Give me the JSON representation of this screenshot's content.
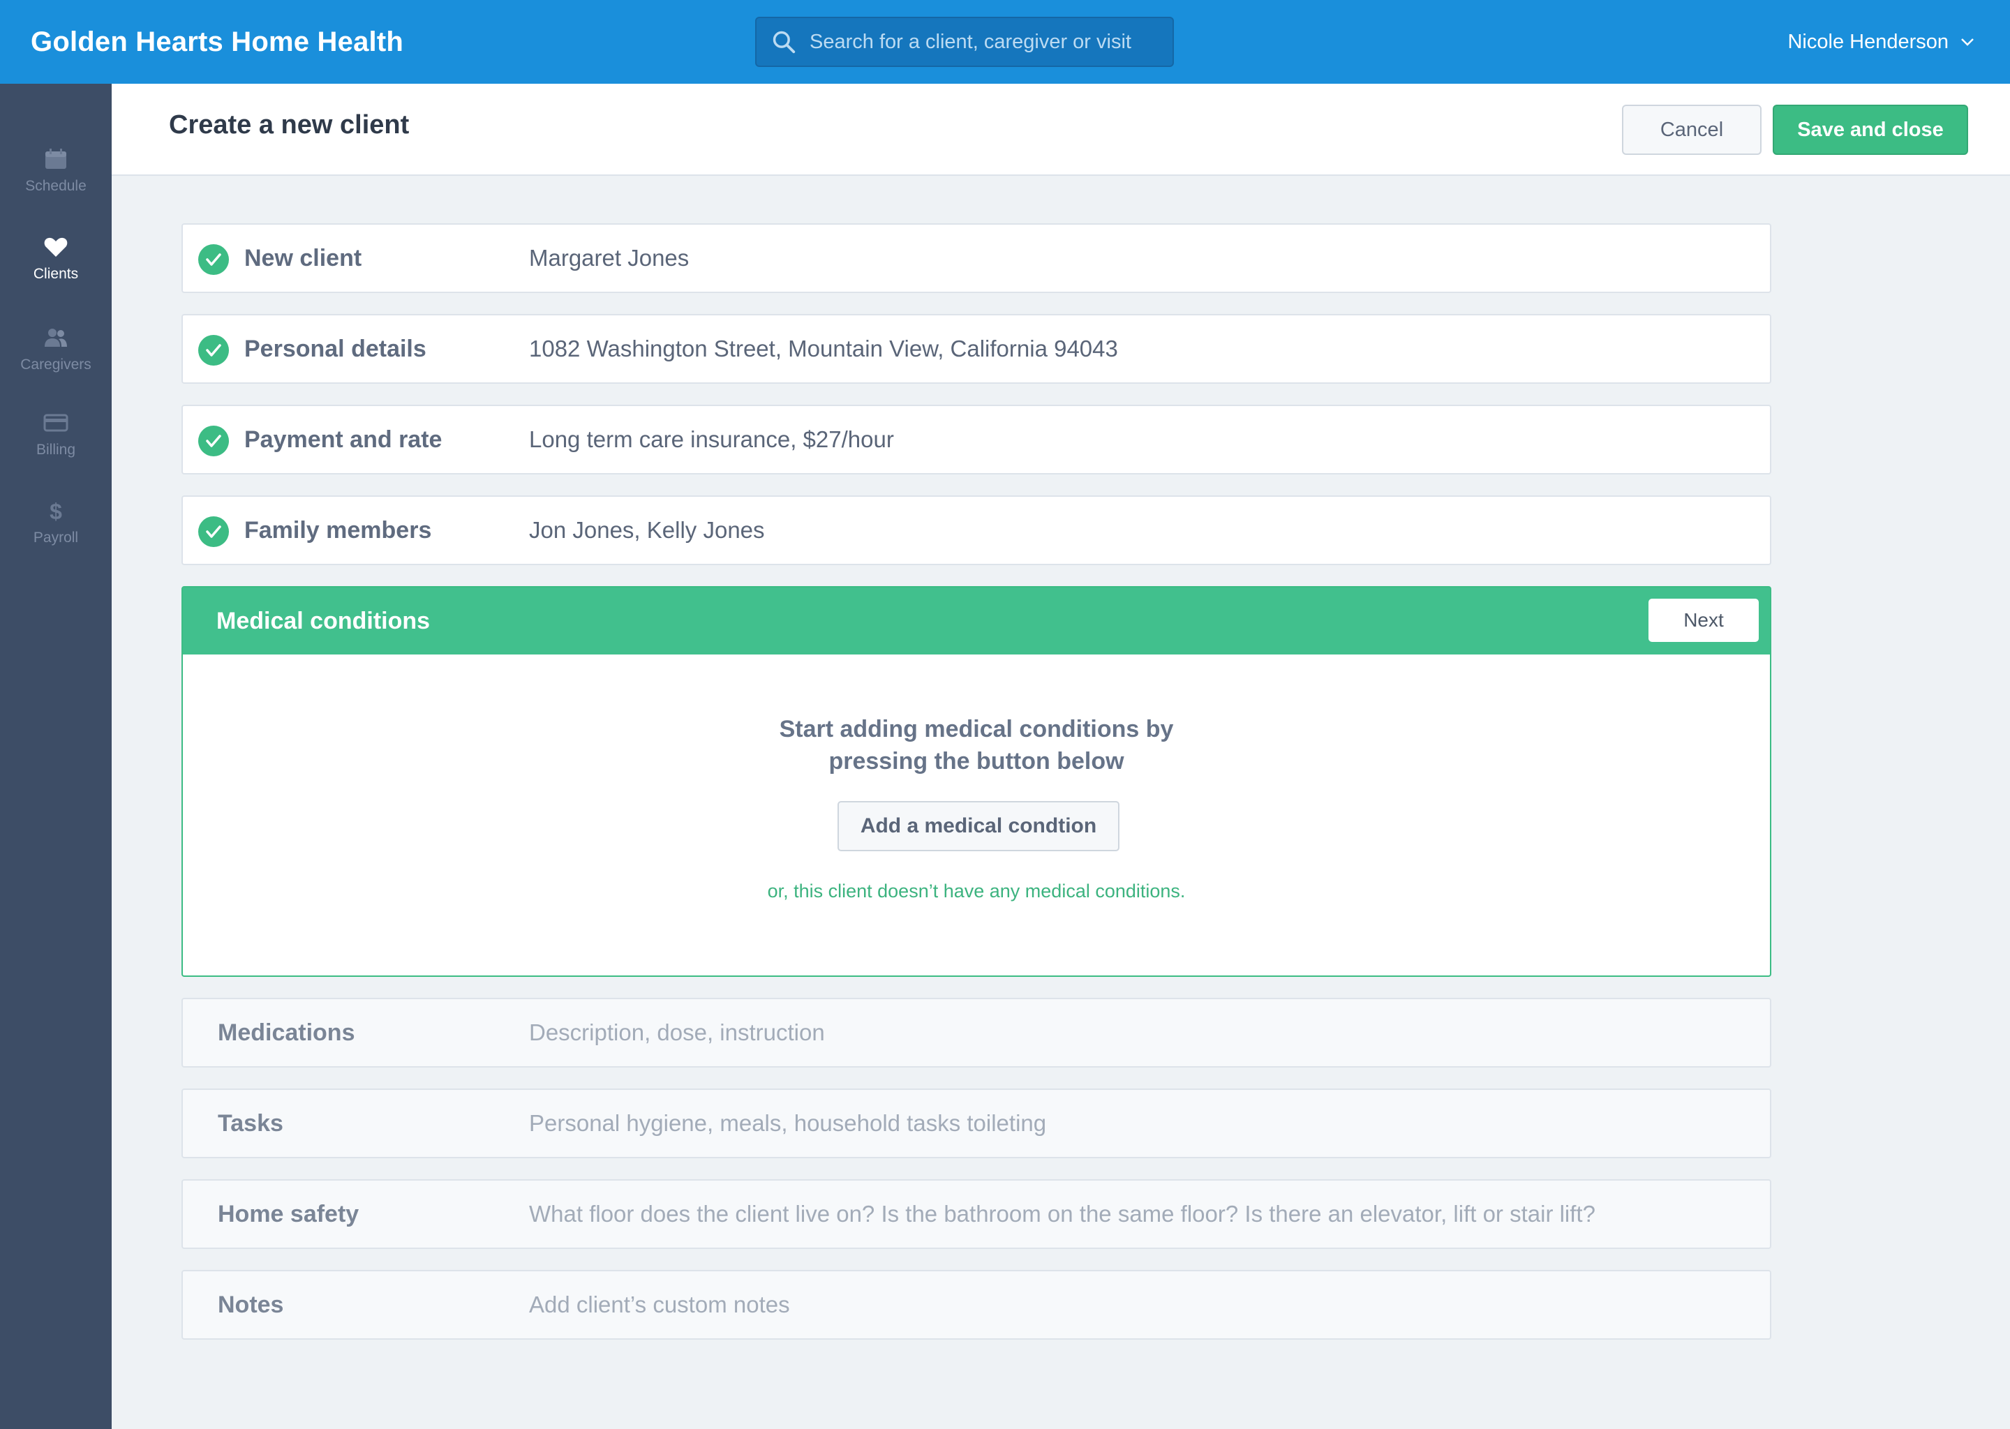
{
  "app": {
    "brand": "Golden Hearts Home Health",
    "search_placeholder": "Search for a client, caregiver or visit",
    "user_name": "Nicole Henderson"
  },
  "sidebar": {
    "items": [
      {
        "label": "Schedule",
        "icon": "calendar-icon",
        "active": false
      },
      {
        "label": "Clients",
        "icon": "heart-icon",
        "active": true
      },
      {
        "label": "Caregivers",
        "icon": "users-icon",
        "active": false
      },
      {
        "label": "Billing",
        "icon": "credit-card-icon",
        "active": false
      },
      {
        "label": "Payroll",
        "icon": "dollar-icon",
        "active": false
      }
    ]
  },
  "header": {
    "title": "Create a new client",
    "cancel_label": "Cancel",
    "save_label": "Save and close"
  },
  "completed_sections": [
    {
      "label": "New client",
      "value": "Margaret Jones"
    },
    {
      "label": "Personal details",
      "value": "1082 Washington Street, Mountain View, California 94043"
    },
    {
      "label": "Payment and rate",
      "value": "Long term care insurance, $27/hour"
    },
    {
      "label": "Family members",
      "value": "Jon Jones, Kelly Jones"
    }
  ],
  "active_section": {
    "title": "Medical conditions",
    "next_label": "Next",
    "message_line1": "Start adding medical conditions by",
    "message_line2": "pressing the button below",
    "add_label": "Add a medical condtion",
    "none_link": "or, this client doesn’t have any medical conditions."
  },
  "pending_sections": [
    {
      "label": "Medications",
      "value": "Description, dose, instruction"
    },
    {
      "label": "Tasks",
      "value": "Personal hygiene, meals, household tasks toileting"
    },
    {
      "label": "Home safety",
      "value": "What floor does the client live on? Is the bathroom on the same floor? Is there an elevator, lift or stair lift?"
    },
    {
      "label": "Notes",
      "value": "Add client’s custom notes"
    }
  ],
  "colors": {
    "topbar": "#1a8fdb",
    "sidebar": "#3d4d66",
    "accent_green": "#41c08d"
  }
}
